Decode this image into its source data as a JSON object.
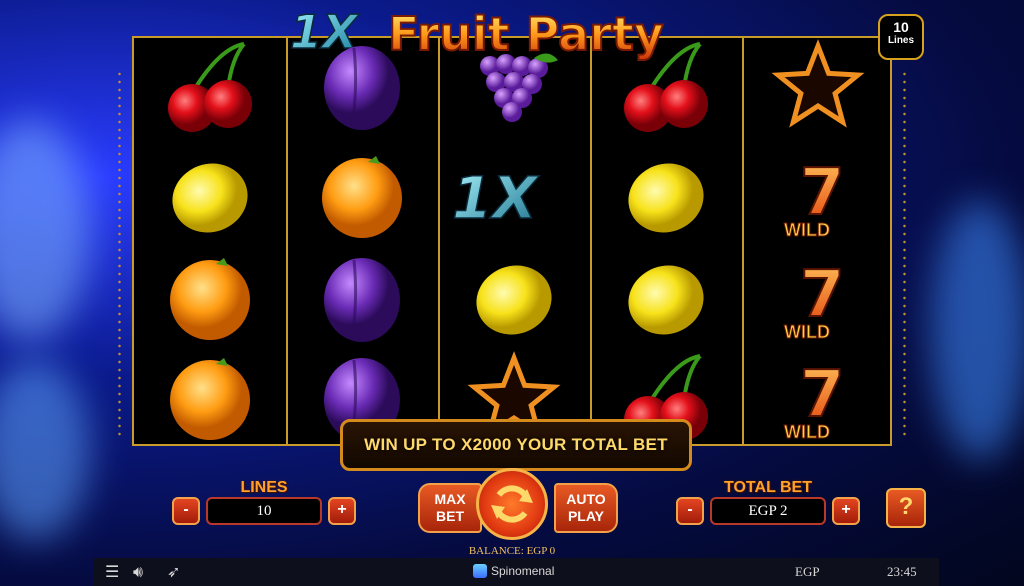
{
  "game": {
    "logo_prefix": "1X",
    "title": "Fruit Party",
    "lines_badge": {
      "value": "10",
      "label": "Lines"
    }
  },
  "reels": [
    [
      "cherry",
      "lemon",
      "orange",
      "orange"
    ],
    [
      "plum",
      "orange",
      "plum",
      "plum"
    ],
    [
      "grapes",
      "1x-logo",
      "lemon",
      "star"
    ],
    [
      "cherry",
      "lemon",
      "lemon",
      "cherry"
    ],
    [
      "star",
      "wild-seven",
      "wild-seven",
      "wild-seven"
    ]
  ],
  "wild_label": "WILD",
  "banner_text": "WIN UP TO X2000 YOUR TOTAL BET",
  "controls": {
    "lines_label": "LINES",
    "lines_value": "10",
    "minus": "-",
    "plus": "+",
    "max_bet": {
      "line1": "MAX",
      "line2": "BET"
    },
    "auto_play": {
      "line1": "AUTO",
      "line2": "PLAY"
    },
    "total_bet_label": "TOTAL BET",
    "total_bet_value": "EGP 2",
    "help": "?"
  },
  "status": {
    "balance": "BALANCE: EGP 0",
    "provider": "Spinomenal",
    "currency": "EGP",
    "time": "23:45"
  },
  "colors": {
    "accent_gold": "#d9a21c",
    "button_red": "#c8330f",
    "label_orange": "#ffa12a"
  }
}
